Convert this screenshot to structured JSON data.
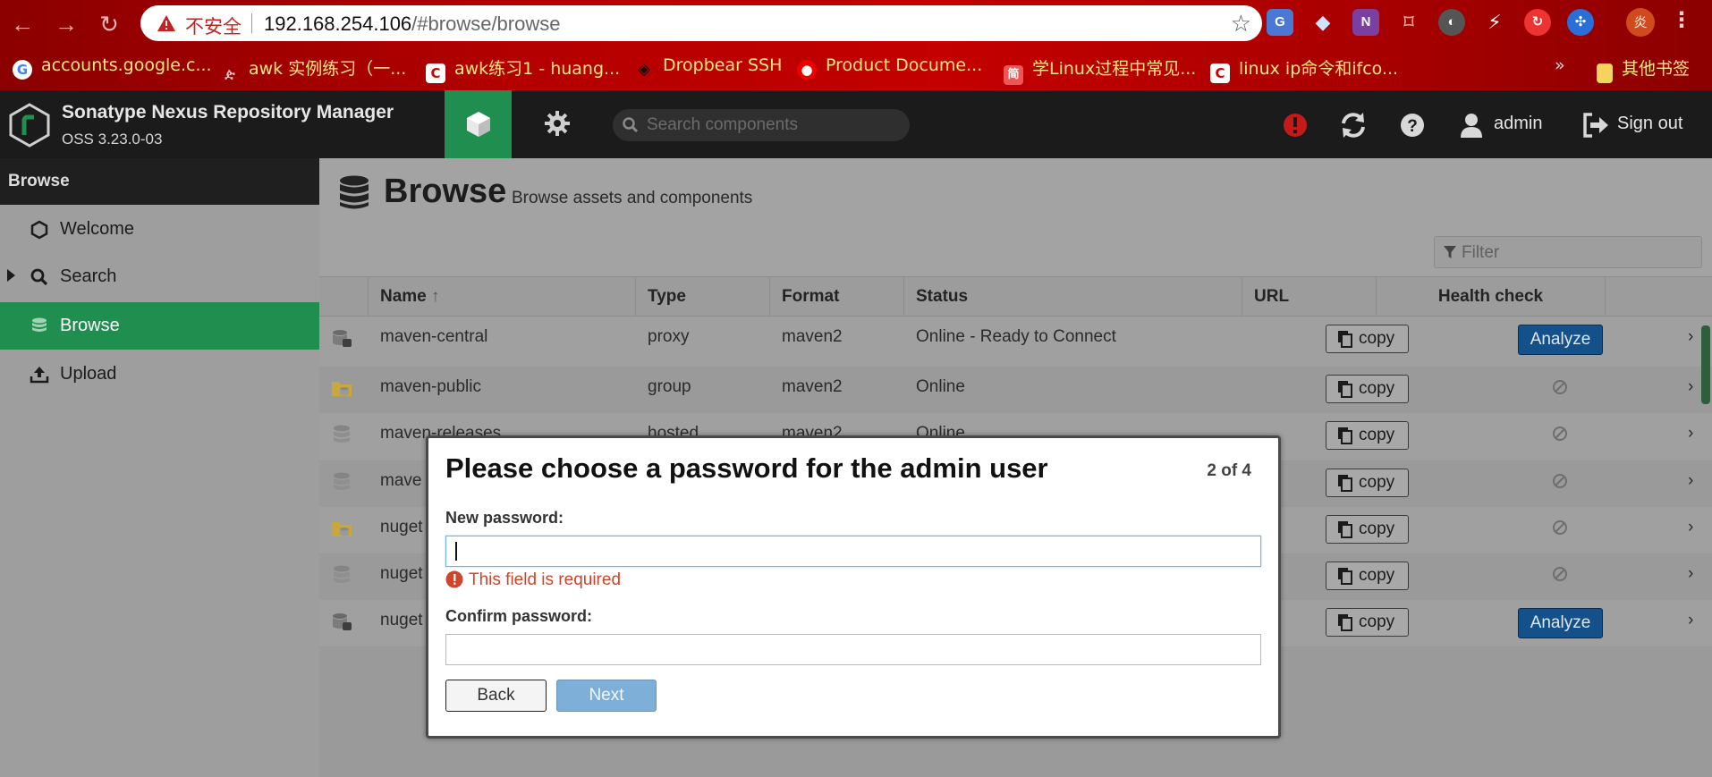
{
  "browser": {
    "insecure_label": "不安全",
    "url_host": "192.168.254.106",
    "url_path": "/#browse/browse",
    "profile_initial": "炎",
    "bookmarks": [
      {
        "label": "accounts.google.c..."
      },
      {
        "label": "awk 实例练习（一..."
      },
      {
        "label": "awk练习1 - huang..."
      },
      {
        "label": "Dropbear SSH"
      },
      {
        "label": "Product Docume..."
      },
      {
        "label": "学Linux过程中常见..."
      },
      {
        "label": "linux ip命令和ifco..."
      },
      {
        "label": "其他书签"
      }
    ],
    "overflow": "»"
  },
  "header": {
    "title": "Sonatype Nexus Repository Manager",
    "version": "OSS 3.23.0-03",
    "search_placeholder": "Search components",
    "user": "admin",
    "sign_out": "Sign out"
  },
  "sidebar": {
    "heading": "Browse",
    "items": [
      {
        "label": "Welcome"
      },
      {
        "label": "Search"
      },
      {
        "label": "Browse"
      },
      {
        "label": "Upload"
      }
    ]
  },
  "page": {
    "title": "Browse",
    "subtitle": "Browse assets and components",
    "filter_placeholder": "Filter"
  },
  "grid": {
    "columns": [
      "Name",
      "Type",
      "Format",
      "Status",
      "URL",
      "Health check"
    ],
    "sort_indicator": "↑",
    "copy_label": "copy",
    "analyze_label": "Analyze",
    "rows": [
      {
        "name": "maven-central",
        "type": "proxy",
        "format": "maven2",
        "status": "Online - Ready to Connect",
        "kind": "proxy",
        "health": "analyze"
      },
      {
        "name": "maven-public",
        "type": "group",
        "format": "maven2",
        "status": "Online",
        "kind": "group",
        "health": "none"
      },
      {
        "name": "maven-releases",
        "type": "hosted",
        "format": "maven2",
        "status": "Online",
        "kind": "hosted",
        "health": "none"
      },
      {
        "name": "mave",
        "type": "",
        "format": "",
        "status": "",
        "kind": "hosted",
        "health": "none"
      },
      {
        "name": "nuget",
        "type": "",
        "format": "",
        "status": "",
        "kind": "group",
        "health": "none"
      },
      {
        "name": "nuget",
        "type": "",
        "format": "",
        "status": "",
        "kind": "hosted",
        "health": "none"
      },
      {
        "name": "nuget",
        "type": "",
        "format": "",
        "status": "",
        "kind": "proxy",
        "health": "analyze"
      }
    ]
  },
  "modal": {
    "title": "Please choose a password for the admin user",
    "step": "2 of 4",
    "new_password_label": "New password:",
    "new_password_value": "",
    "error": "This field is required",
    "confirm_password_label": "Confirm password:",
    "confirm_password_value": "",
    "back_label": "Back",
    "next_label": "Next"
  },
  "colors": {
    "accent_green": "#1f8e4f",
    "analyze_blue": "#14508a",
    "error_red": "#d0442a",
    "chrome_red": "#b30000"
  }
}
